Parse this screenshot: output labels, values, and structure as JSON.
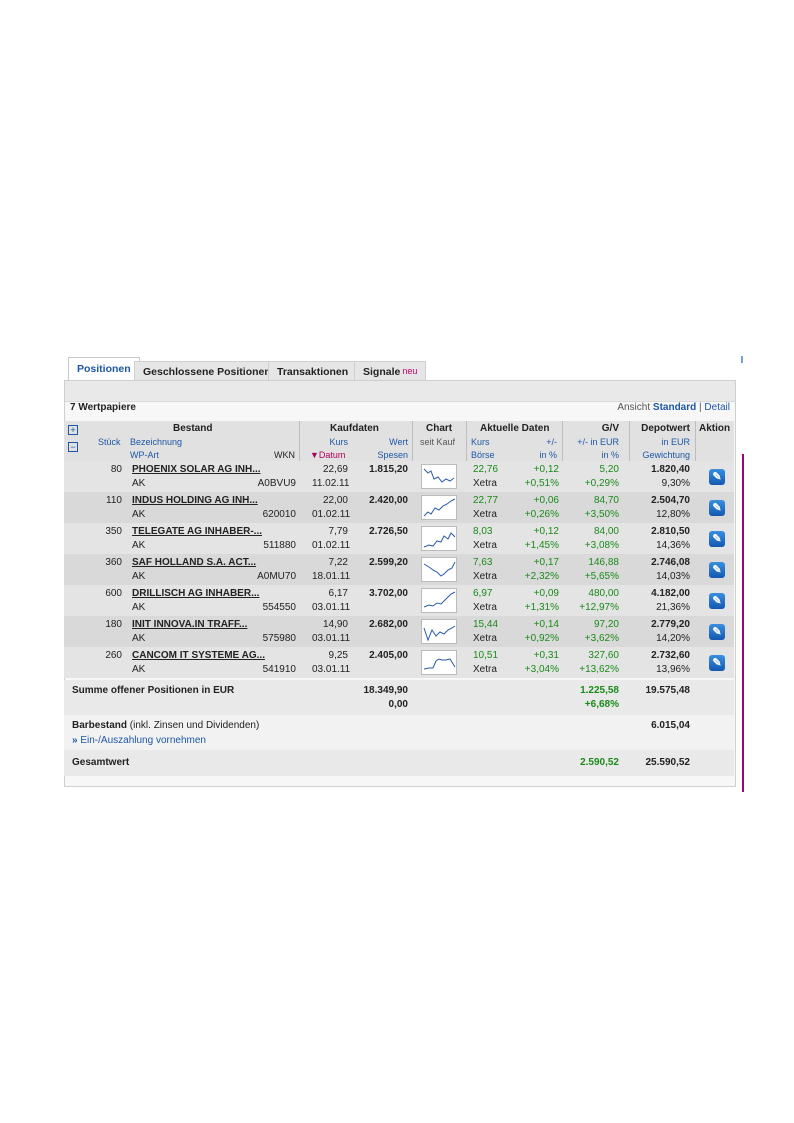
{
  "tabs": [
    {
      "label": "Positionen"
    },
    {
      "label": "Geschlossene Positionen"
    },
    {
      "label": "Transaktionen"
    },
    {
      "label": "Signale",
      "badge": "neu"
    }
  ],
  "summary_count": "7 Wertpapiere",
  "view": {
    "label": "Ansicht",
    "standard": "Standard",
    "sep": "|",
    "detail": "Detail"
  },
  "headers": {
    "bestand": "Bestand",
    "stueck": "Stück",
    "bezeichnung": "Bezeichnung",
    "wp_art": "WP-Art",
    "wkn": "WKN",
    "kaufdaten": "Kaufdaten",
    "kurs": "Kurs",
    "wert": "Wert",
    "datum": "Datum",
    "spesen": "Spesen",
    "chart": "Chart",
    "seit_kauf": "seit Kauf",
    "aktuelle": "Aktuelle Daten",
    "akt_kurs": "Kurs",
    "plusminus": "+/-",
    "boerse": "Börse",
    "in_pct": "in %",
    "gv": "G/V",
    "pm_eur": "+/- in EUR",
    "gv_pct": "in %",
    "depotwert": "Depotwert",
    "in_eur": "in EUR",
    "gewichtung": "Gewichtung",
    "aktion": "Aktion"
  },
  "rows": [
    {
      "stueck": "80",
      "name": "PHOENIX SOLAR AG INH...",
      "art": "AK",
      "wkn": "A0BVU9",
      "kurs": "22,69",
      "datum": "11.02.11",
      "wert": "1.815,20",
      "spesen": "",
      "akt_kurs": "22,76",
      "boerse": "Xetra",
      "plusminus": "+0,12",
      "pct": "+0,51%",
      "gv_eur": "5,20",
      "gv_pct": "+0,29%",
      "depot": "1.820,40",
      "gew": "9,30%"
    },
    {
      "stueck": "110",
      "name": "INDUS HOLDING AG INH...",
      "art": "AK",
      "wkn": "620010",
      "kurs": "22,00",
      "datum": "01.02.11",
      "wert": "2.420,00",
      "spesen": "",
      "akt_kurs": "22,77",
      "boerse": "Xetra",
      "plusminus": "+0,06",
      "pct": "+0,26%",
      "gv_eur": "84,70",
      "gv_pct": "+3,50%",
      "depot": "2.504,70",
      "gew": "12,80%"
    },
    {
      "stueck": "350",
      "name": "TELEGATE AG INHABER-...",
      "art": "AK",
      "wkn": "511880",
      "kurs": "7,79",
      "datum": "01.02.11",
      "wert": "2.726,50",
      "spesen": "",
      "akt_kurs": "8,03",
      "boerse": "Xetra",
      "plusminus": "+0,12",
      "pct": "+1,45%",
      "gv_eur": "84,00",
      "gv_pct": "+3,08%",
      "depot": "2.810,50",
      "gew": "14,36%"
    },
    {
      "stueck": "360",
      "name": "SAF HOLLAND S.A. ACT...",
      "art": "AK",
      "wkn": "A0MU70",
      "kurs": "7,22",
      "datum": "18.01.11",
      "wert": "2.599,20",
      "spesen": "",
      "akt_kurs": "7,63",
      "boerse": "Xetra",
      "plusminus": "+0,17",
      "pct": "+2,32%",
      "gv_eur": "146,88",
      "gv_pct": "+5,65%",
      "depot": "2.746,08",
      "gew": "14,03%"
    },
    {
      "stueck": "600",
      "name": "DRILLISCH AG INHABER...",
      "art": "AK",
      "wkn": "554550",
      "kurs": "6,17",
      "datum": "03.01.11",
      "wert": "3.702,00",
      "spesen": "",
      "akt_kurs": "6,97",
      "boerse": "Xetra",
      "plusminus": "+0,09",
      "pct": "+1,31%",
      "gv_eur": "480,00",
      "gv_pct": "+12,97%",
      "depot": "4.182,00",
      "gew": "21,36%"
    },
    {
      "stueck": "180",
      "name": "INIT INNOVA.IN TRAFF...",
      "art": "AK",
      "wkn": "575980",
      "kurs": "14,90",
      "datum": "03.01.11",
      "wert": "2.682,00",
      "spesen": "",
      "akt_kurs": "15,44",
      "boerse": "Xetra",
      "plusminus": "+0,14",
      "pct": "+0,92%",
      "gv_eur": "97,20",
      "gv_pct": "+3,62%",
      "depot": "2.779,20",
      "gew": "14,20%"
    },
    {
      "stueck": "260",
      "name": "CANCOM IT SYSTEME AG...",
      "art": "AK",
      "wkn": "541910",
      "kurs": "9,25",
      "datum": "03.01.11",
      "wert": "2.405,00",
      "spesen": "",
      "akt_kurs": "10,51",
      "boerse": "Xetra",
      "plusminus": "+0,31",
      "pct": "+3,04%",
      "gv_eur": "327,60",
      "gv_pct": "+13,62%",
      "depot": "2.732,60",
      "gew": "13,96%"
    }
  ],
  "summe": {
    "label": "Summe offener Positionen in EUR",
    "wert": "18.349,90",
    "spesen": "0,00",
    "gv_eur": "1.225,58",
    "gv_pct": "+6,68%",
    "depot": "19.575,48"
  },
  "barbestand": {
    "label": "Barbestand",
    "note": "(inkl. Zinsen und Dividenden)",
    "link": "Ein-/Auszahlung vornehmen",
    "depot": "6.015,04"
  },
  "gesamt": {
    "label": "Gesamtwert",
    "gv_eur": "2.590,52",
    "depot": "25.590,52"
  },
  "icons": {
    "expand": "expand-all-icon",
    "collapse": "collapse-all-icon",
    "sort": "sort-desc-icon",
    "edit": "edit-icon"
  }
}
